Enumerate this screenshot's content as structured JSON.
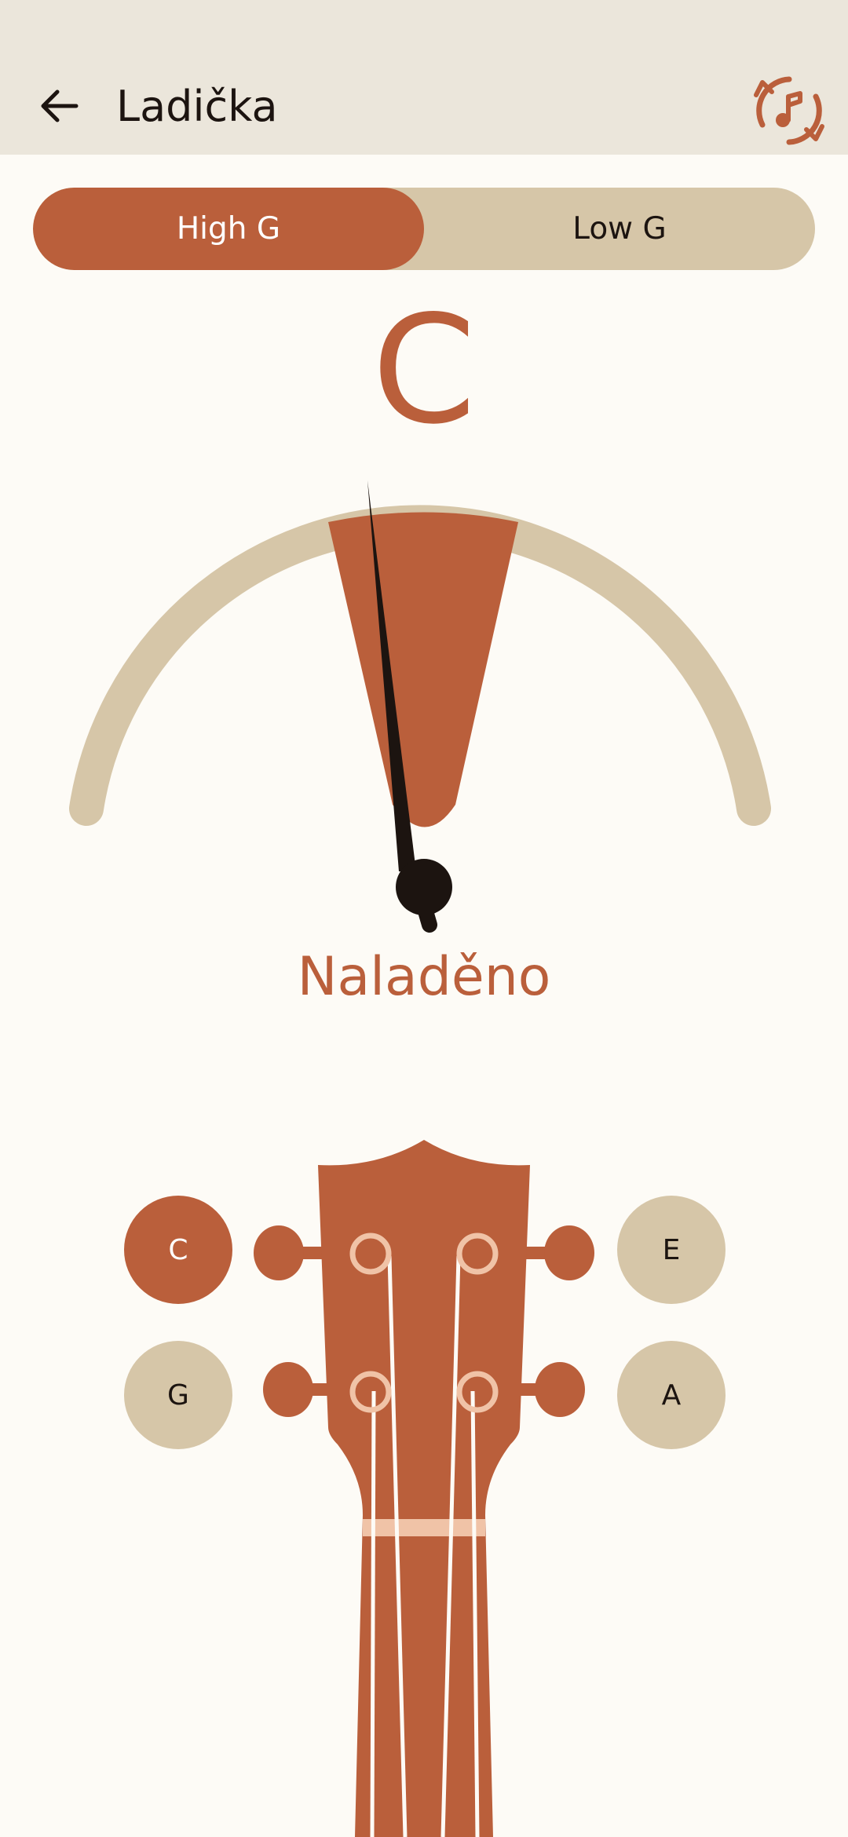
{
  "header": {
    "title": "Ladička",
    "back_icon": "arrow-left-icon",
    "reset_icon": "refresh-music-icon"
  },
  "tuning_mode": {
    "options": [
      "High G",
      "Low G"
    ],
    "selected": "High G"
  },
  "tuner": {
    "current_note": "C",
    "status": "Naladěno"
  },
  "strings": {
    "left_top": "C",
    "left_bottom": "G",
    "right_top": "E",
    "right_bottom": "A",
    "selected": "C"
  },
  "colors": {
    "accent": "#ba5f3b",
    "track": "#d6c6a8",
    "appbar": "#ebe6db",
    "background": "#fdfbf6",
    "text": "#1c1410"
  }
}
